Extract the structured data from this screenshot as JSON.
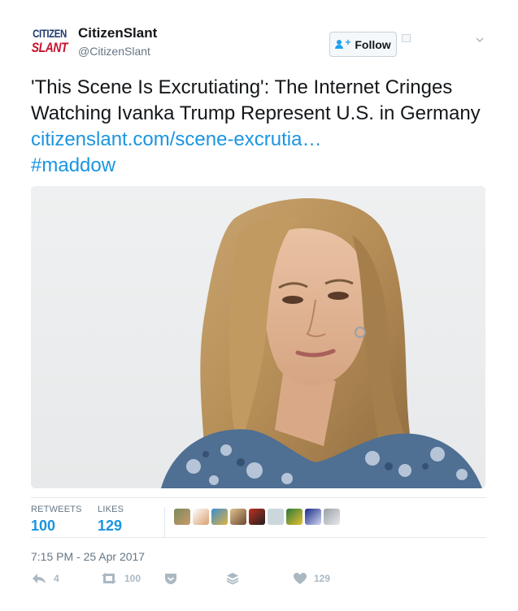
{
  "account": {
    "avatar_line1": "CITIZEN",
    "avatar_line2": "SLANT",
    "name": "CitizenSlant",
    "handle": "@CitizenSlant"
  },
  "follow_button": {
    "label": "Follow",
    "icon": "add-user-icon"
  },
  "tweet": {
    "text": "'This Scene Is Excrutiating': The Internet Cringes Watching Ivanka Trump Represent U.S. in Germany ",
    "link": "citizenslant.com/scene-excrutia…",
    "hashtag": "#maddow"
  },
  "stats": {
    "retweets_label": "RETWEETS",
    "retweets": "100",
    "likes_label": "LIKES",
    "likes": "129"
  },
  "timestamp": "7:15 PM - 25 Apr 2017",
  "actions": {
    "reply_count": "4",
    "retweet_count": "100",
    "like_count": "129"
  },
  "colors": {
    "link": "#1b95e0",
    "muted": "#657786",
    "icon": "#aab8c2"
  }
}
